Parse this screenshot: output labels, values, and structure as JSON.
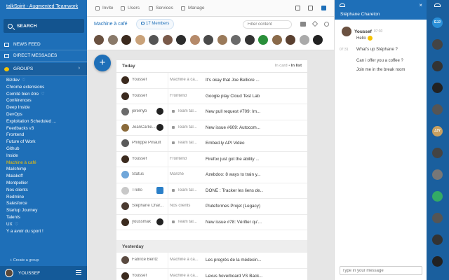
{
  "sidebar": {
    "title": "talkSpirit - Augmented Teamwork",
    "search_label": "SEARCH",
    "nav": [
      {
        "label": "NEWS FEED"
      },
      {
        "label": "DIRECT MESSAGES"
      },
      {
        "label": "GROUPS"
      }
    ],
    "groups": [
      "Bizdev",
      "Chrome extensions",
      "Comité bien être",
      "Conférences",
      "Deep Inside",
      "DevOps",
      "Exploitation Scheduled ...",
      "Feedbacks v3",
      "Frontend",
      "Future of Work",
      "Github",
      "Inside",
      "Machine à café",
      "Mailchimp",
      "Malakoff",
      "Montpellier",
      "Nos clients",
      "Redmine",
      "Salesforce",
      "Startup Journey",
      "Talents",
      "UX",
      "Y a avoir du sport !"
    ],
    "active_group": "Machine à café",
    "create_group": "+ Create a group",
    "user": "YOUSSEF"
  },
  "topbar": {
    "invite": "Invite",
    "users": "Users",
    "services": "Services",
    "manage": "Manage"
  },
  "group": {
    "name": "Machine à café",
    "members": "17 Members",
    "filter_placeholder": "Filter content"
  },
  "feed": {
    "today": "Today",
    "view_card": "In card",
    "view_list": "In list",
    "yesterday": "Yesterday",
    "rows": [
      {
        "who": "Youssef",
        "app": "",
        "group": "Machine à ca...",
        "locked": false,
        "title": "It's okay that Joe Belliore ...",
        "color": "#3b2a1e"
      },
      {
        "who": "Youssef",
        "app": "",
        "group": "Frontend",
        "locked": false,
        "title": "Google play Cloud Test Lab",
        "color": "#3b2a1e"
      },
      {
        "who": "jeremyb",
        "app": "github",
        "group": "Team tal...",
        "locked": true,
        "title": "New pull request #709: Im...",
        "color": "#6b6b6b"
      },
      {
        "who": "JeanCarlie...",
        "app": "github",
        "group": "Team tal...",
        "locked": true,
        "title": "New issue #609: Autocom...",
        "color": "#8a6a3a"
      },
      {
        "who": "Philippe Pinault",
        "app": "",
        "group": "Team tal...",
        "locked": true,
        "title": "Embed.ly API Vidéo",
        "color": "#5a5a5a"
      },
      {
        "who": "Youssef",
        "app": "",
        "group": "Frontend",
        "locked": false,
        "title": "Firefox just got the ability ...",
        "color": "#3b2a1e"
      },
      {
        "who": "Status",
        "app": "",
        "group": "Marché",
        "locked": false,
        "title": "Azebdoo: 8 ways to train y...",
        "color": "#6fa6d9"
      },
      {
        "who": "Trello",
        "app": "trello",
        "group": "Team tal...",
        "locked": true,
        "title": "DONE : Tracker les liens de...",
        "color": "#c8c8c8"
      },
      {
        "who": "Stéphane Char...",
        "app": "",
        "group": "Nos clients",
        "locked": false,
        "title": "Pluteformes Projet (Legacy)",
        "color": "#4a3a30"
      },
      {
        "who": "youssmak",
        "app": "github",
        "group": "Team tal...",
        "locked": true,
        "title": "New issue #78: Vérifier qu'...",
        "color": "#3b2a1e"
      }
    ],
    "rows_yesterday": [
      {
        "who": "Fabrice Bentz",
        "app": "",
        "group": "Machine à ca...",
        "locked": false,
        "title": "Les progrès de la médecin...",
        "color": "#5a4a40"
      },
      {
        "who": "Youssef",
        "app": "",
        "group": "Machine à ca...",
        "locked": false,
        "title": "Lexus hoverboard VS Back...",
        "color": "#3b2a1e"
      }
    ]
  },
  "chat": {
    "contact": "Stéphane Chareton",
    "author": "Youssef",
    "time1": "07:30",
    "time2": "07:31",
    "messages": [
      "Hello",
      "What's up Stéphane ?",
      "Can i offer you a coffee ?",
      "Join me in the break room"
    ],
    "input_placeholder": "Type in your message"
  },
  "rail": {
    "avatars": [
      {
        "text": "EJJ",
        "color": "#2a8fd8"
      },
      {
        "text": "",
        "color": "#444"
      },
      {
        "text": "",
        "color": "#333"
      },
      {
        "text": "",
        "color": "#222"
      },
      {
        "text": "",
        "color": "#555"
      },
      {
        "text": "JJY",
        "color": "#c8a060"
      },
      {
        "text": "",
        "color": "#444"
      },
      {
        "text": "",
        "color": "#777"
      },
      {
        "text": "",
        "color": "#3a6"
      },
      {
        "text": "",
        "color": "#555"
      },
      {
        "text": "",
        "color": "#333"
      },
      {
        "text": "",
        "color": "#222"
      }
    ]
  },
  "colors": {
    "brand": "#1e6fb8",
    "accent": "#f5c200"
  }
}
